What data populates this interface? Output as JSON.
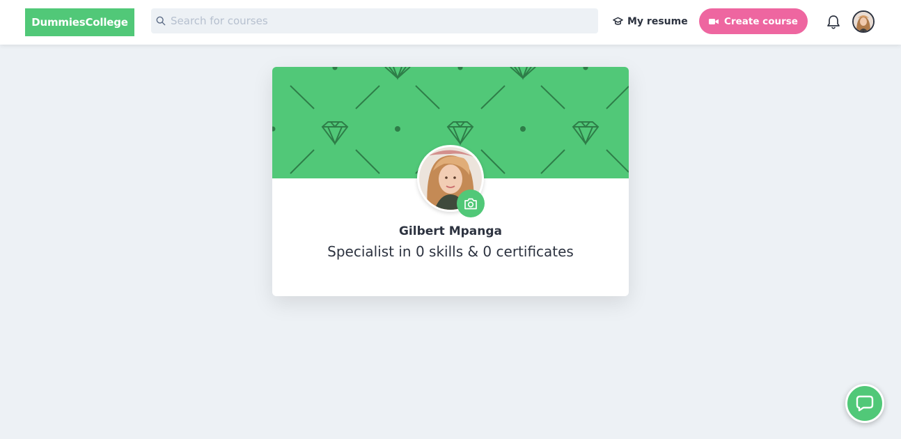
{
  "header": {
    "logo": "DummiesCollege",
    "search": {
      "placeholder": "Search for courses",
      "value": "",
      "icon": "search-icon"
    },
    "resume_label": "My resume",
    "create_label": "Create course",
    "notifications_icon": "bell-icon",
    "avatar_icon": "user-avatar"
  },
  "profile": {
    "name": "Gilbert Mpanga",
    "tagline": "Specialist in 0 skills & 0 certificates",
    "camera_icon": "camera-icon"
  },
  "chat_icon": "chat-icon",
  "colors": {
    "brand_green": "#51c878",
    "pink": "#ee66a0",
    "background": "#edf1f5",
    "text": "#2d3340"
  }
}
